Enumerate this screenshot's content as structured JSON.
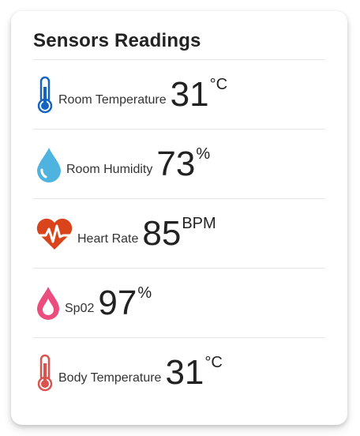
{
  "card": {
    "title": "Sensors Readings"
  },
  "sensors": [
    {
      "label": "Room Temperature",
      "value": "31",
      "unit": "°C",
      "icon": "thermometer-icon",
      "color": "#1565c0"
    },
    {
      "label": "Room Humidity",
      "value": "73",
      "unit": "%",
      "icon": "water-drop-icon",
      "color": "#4fb3e0"
    },
    {
      "label": "Heart Rate",
      "value": "85",
      "unit": "BPM",
      "icon": "heart-pulse-icon",
      "color": "#d9441c"
    },
    {
      "label": "Sp02",
      "value": "97",
      "unit": "%",
      "icon": "blood-drop-icon",
      "color": "#ec4d7f"
    },
    {
      "label": "Body Temperature",
      "value": "31",
      "unit": "°C",
      "icon": "thermometer-icon",
      "color": "#d9534f"
    }
  ]
}
